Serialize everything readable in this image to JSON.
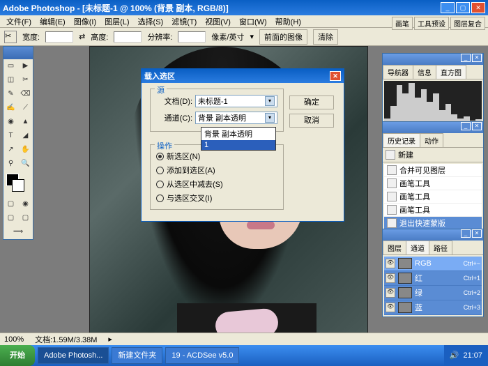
{
  "app": {
    "title": "Adobe Photoshop - [未标题-1 @ 100% (背景 副本, RGB/8)]"
  },
  "menu": [
    "文件(F)",
    "编辑(E)",
    "图像(I)",
    "图层(L)",
    "选择(S)",
    "滤镜(T)",
    "视图(V)",
    "窗口(W)",
    "帮助(H)"
  ],
  "optionbar": {
    "width_label": "宽度:",
    "height_label": "高度:",
    "res_label": "分辨率:",
    "unit": "像素/英寸",
    "front_image": "前面的图像",
    "clear": "清除"
  },
  "welltabs": [
    "画笔",
    "工具预设",
    "图层复合"
  ],
  "tools": [
    "▭",
    "▶",
    "◫",
    "✂",
    "✎",
    "⌫",
    "✍",
    "⟋",
    "◉",
    "▲",
    "T",
    "◢",
    "↗",
    "✋",
    "⚲",
    "🔍"
  ],
  "nav_panel": {
    "tabs": [
      "导航器",
      "信息",
      "直方图"
    ],
    "active": 2
  },
  "history_panel": {
    "tabs": [
      "历史记录",
      "动作"
    ],
    "active": 0,
    "doc": "新建",
    "items": [
      "合并可见图层",
      "画笔工具",
      "画笔工具",
      "画笔工具",
      "退出快速蒙版"
    ],
    "active_idx": 4
  },
  "channels_panel": {
    "tabs": [
      "图层",
      "通道",
      "路径"
    ],
    "active": 1,
    "items": [
      {
        "name": "RGB",
        "key": "Ctrl+~",
        "vis": true,
        "rgb": true
      },
      {
        "name": "红",
        "key": "Ctrl+1",
        "vis": true
      },
      {
        "name": "绿",
        "key": "Ctrl+2",
        "vis": true
      },
      {
        "name": "蓝",
        "key": "Ctrl+3",
        "vis": true
      }
    ]
  },
  "dialog": {
    "title": "载入选区",
    "source_legend": "源",
    "doc_label": "文档(D):",
    "doc_value": "未标题-1",
    "chan_label": "通道(C):",
    "chan_value": "背景 副本透明",
    "dropdown_opts": [
      "背景 副本透明",
      "1"
    ],
    "dropdown_sel": 1,
    "op_legend": "操作",
    "ops": [
      "新选区(N)",
      "添加到选区(A)",
      "从选区中减去(S)",
      "与选区交叉(I)"
    ],
    "op_checked": 0,
    "ok": "确定",
    "cancel": "取消"
  },
  "status": {
    "zoom": "100%",
    "doc": "文档:1.59M/3.38M"
  },
  "taskbar": {
    "start": "开始",
    "tasks": [
      "Adobe Photosh...",
      "新建文件夹",
      "19 - ACDSee v5.0"
    ],
    "active": 0,
    "time": "21:07"
  }
}
